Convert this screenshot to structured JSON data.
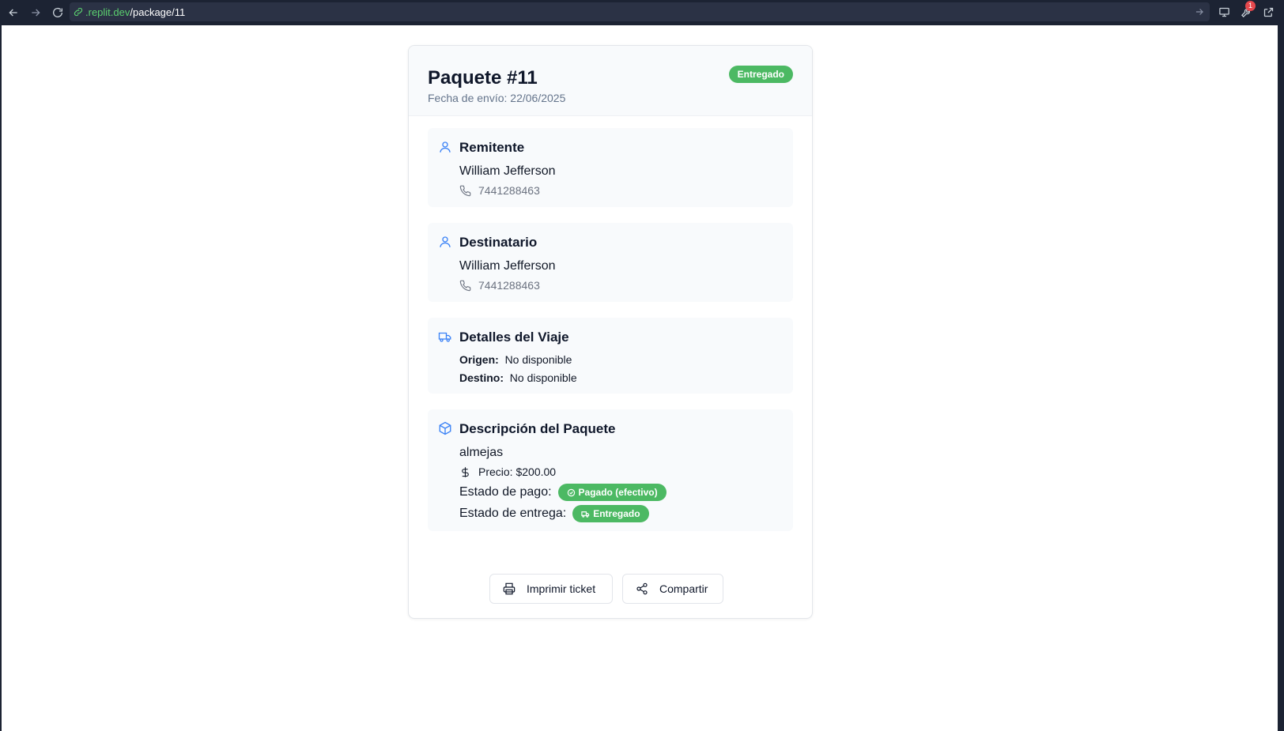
{
  "browser": {
    "url_host": ".replit.dev",
    "url_path": "/package/11",
    "notification_count": "1"
  },
  "package": {
    "title": "Paquete #11",
    "ship_date": "Fecha de envío: 22/06/2025",
    "status": "Entregado"
  },
  "sender": {
    "heading": "Remitente",
    "name": "William Jefferson",
    "phone": "7441288463"
  },
  "recipient": {
    "heading": "Destinatario",
    "name": "William Jefferson",
    "phone": "7441288463"
  },
  "trip": {
    "heading": "Detalles del Viaje",
    "origin_label": "Origen:",
    "origin_value": "No disponible",
    "destination_label": "Destino:",
    "destination_value": "No disponible"
  },
  "description": {
    "heading": "Descripción del Paquete",
    "text": "almejas",
    "price_label": "Precio:",
    "price_value": "$200.00",
    "payment_label": "Estado de pago:",
    "payment_status": "Pagado (efectivo)",
    "delivery_label": "Estado de entrega:",
    "delivery_status": "Entregado"
  },
  "actions": {
    "print_label": "Imprimir ticket",
    "share_label": "Compartir"
  },
  "colors": {
    "accent": "#3b82f6",
    "success": "#4cb963",
    "url_host": "#5bd06f"
  },
  "icons": [
    "back-icon",
    "forward-icon",
    "reload-icon",
    "link-icon",
    "arrow-right-icon",
    "monitor-icon",
    "wrench-icon",
    "external-link-icon",
    "user-icon",
    "phone-icon",
    "truck-icon",
    "box-icon",
    "dollar-icon",
    "check-circle-icon",
    "printer-icon",
    "share-icon"
  ]
}
